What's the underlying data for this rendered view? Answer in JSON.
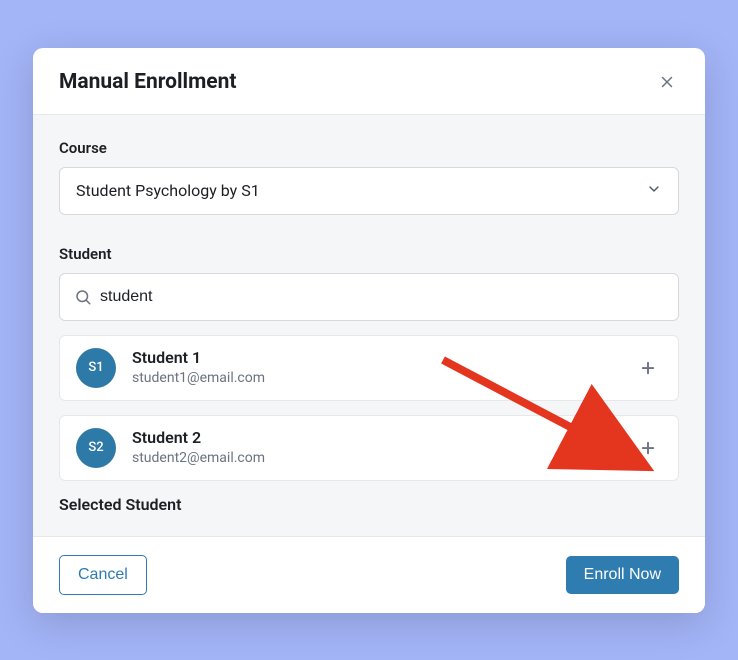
{
  "modal": {
    "title": "Manual Enrollment"
  },
  "course": {
    "label": "Course",
    "selected": "Student Psychology by S1"
  },
  "student": {
    "label": "Student",
    "search_value": "student"
  },
  "students": [
    {
      "initials": "S1",
      "name": "Student 1",
      "email": "student1@email.com"
    },
    {
      "initials": "S2",
      "name": "Student 2",
      "email": "student2@email.com"
    }
  ],
  "selected_label": "Selected Student",
  "footer": {
    "cancel": "Cancel",
    "enroll": "Enroll Now"
  }
}
